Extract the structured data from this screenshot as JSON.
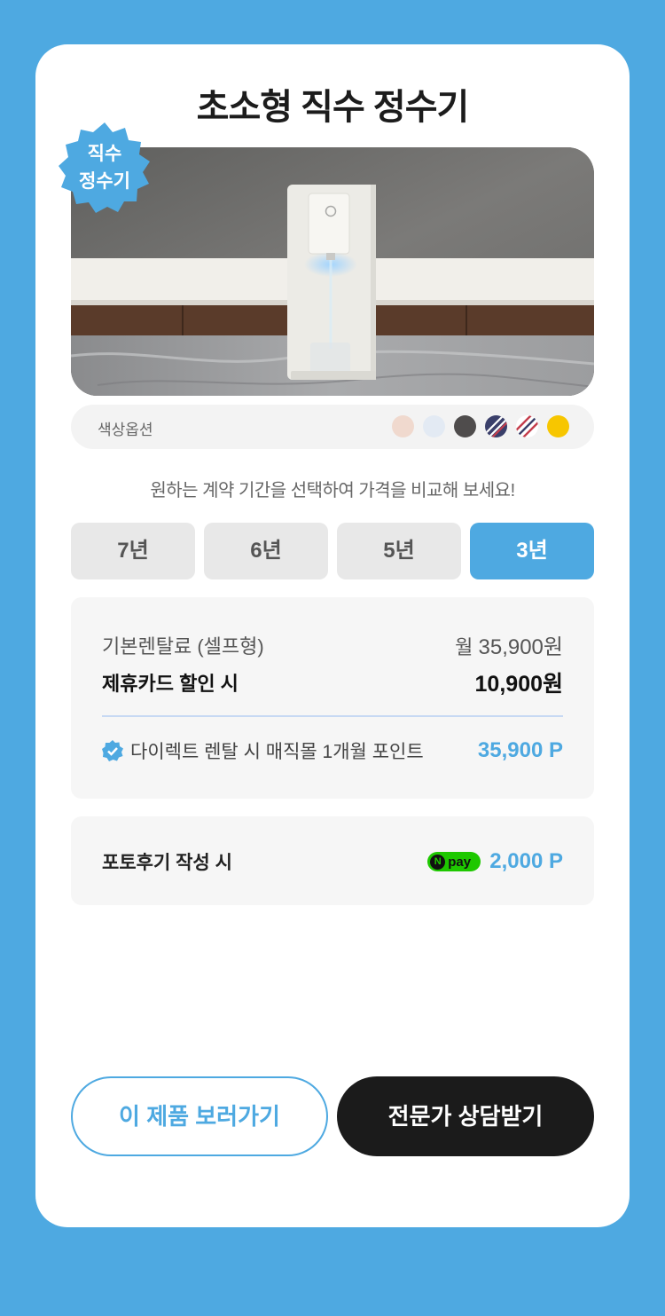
{
  "title": "초소형 직수 정수기",
  "badge": {
    "line1": "직수",
    "line2": "정수기"
  },
  "color_option": {
    "label": "색상옵션",
    "swatches": [
      {
        "name": "pink-beige",
        "color": "#f0d9ce"
      },
      {
        "name": "light-blue",
        "color": "#e3eaf3"
      },
      {
        "name": "charcoal",
        "color": "#4f4c4c"
      },
      {
        "name": "navy-red-stripe",
        "color": "#3a3f6a"
      },
      {
        "name": "white-stripe",
        "color": "#ffffff"
      },
      {
        "name": "yellow",
        "color": "#f7c600"
      }
    ]
  },
  "helper_text": "원하는 계약 기간을 선택하여 가격을 비교해 보세요!",
  "tabs": [
    {
      "label": "7년",
      "active": false
    },
    {
      "label": "6년",
      "active": false
    },
    {
      "label": "5년",
      "active": false
    },
    {
      "label": "3년",
      "active": true
    }
  ],
  "pricing": {
    "base_label": "기본렌탈료 (셀프형)",
    "base_prefix": "월",
    "base_amount": "35,900원",
    "discount_label": "제휴카드 할인 시",
    "discount_amount": "10,900원",
    "point_label": "다이렉트 렌탈 시 매직몰 1개월 포인트",
    "point_amount": "35,900 P"
  },
  "review": {
    "label": "포토후기 작성 시",
    "npay_text": "pay",
    "amount": "2,000 P"
  },
  "buttons": {
    "view_product": "이 제품 보러가기",
    "consult": "전문가 상담받기"
  },
  "colors": {
    "accent": "#4ea9e1",
    "dark": "#1b1b1b",
    "npay_green": "#1ec800"
  }
}
